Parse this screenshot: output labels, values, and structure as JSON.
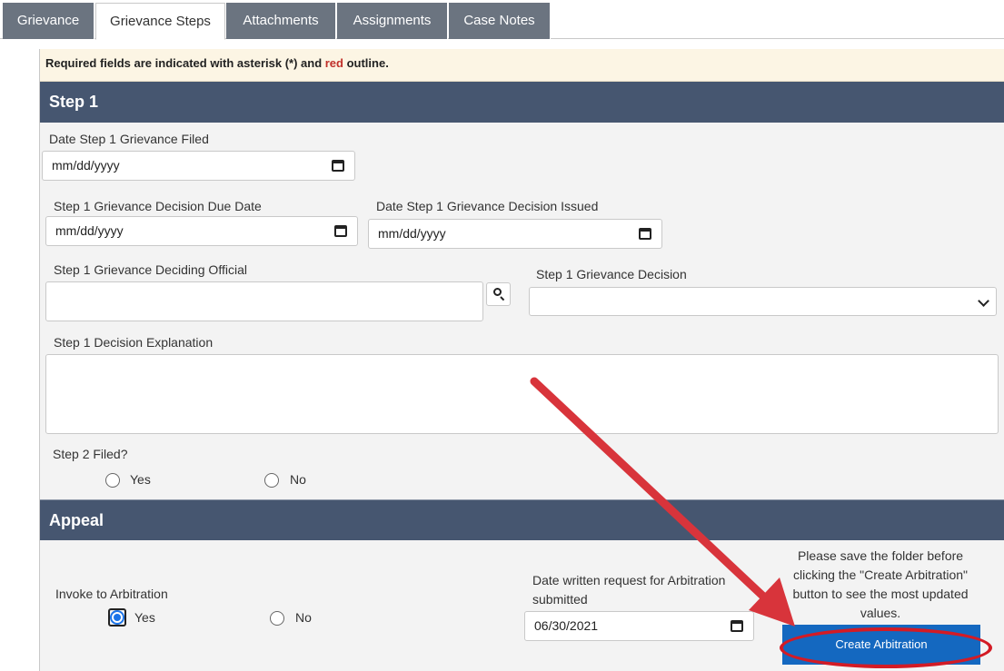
{
  "tabs": [
    {
      "label": "Grievance",
      "active": false
    },
    {
      "label": "Grievance Steps",
      "active": true
    },
    {
      "label": "Attachments",
      "active": false
    },
    {
      "label": "Assignments",
      "active": false
    },
    {
      "label": "Case Notes",
      "active": false
    }
  ],
  "notice": {
    "prefix": "Required fields are indicated with asterisk (*) and ",
    "red_word": "red",
    "suffix": " outline."
  },
  "step1": {
    "title": "Step 1",
    "filed_label": "Date Step 1 Grievance Filed",
    "filed_value": "mm/dd/yyyy",
    "due_label": "Step 1 Grievance Decision Due Date",
    "due_value": "mm/dd/yyyy",
    "issued_label": "Date Step 1 Grievance Decision Issued",
    "issued_value": "mm/dd/yyyy",
    "official_label": "Step 1 Grievance Deciding Official",
    "official_value": "",
    "decision_label": "Step 1 Grievance Decision",
    "decision_value": "",
    "explanation_label": "Step 1 Decision Explanation",
    "explanation_value": "",
    "step2_label": "Step 2 Filed?",
    "yes": "Yes",
    "no": "No"
  },
  "appeal": {
    "title": "Appeal",
    "invoke_label": "Invoke to Arbitration",
    "yes": "Yes",
    "no": "No",
    "invoke_selected": "Yes",
    "request_label_1": "Date written request for Arbitration",
    "request_label_2": "submitted",
    "request_value": "06/30/2021",
    "note": "Please save the folder before clicking the \"Create Arbitration\" button to see the most updated values.",
    "button_label": "Create Arbitration"
  },
  "colors": {
    "header": "#465670",
    "tab": "#6b7480",
    "button": "#1468c0",
    "annotation": "#d31b25"
  }
}
